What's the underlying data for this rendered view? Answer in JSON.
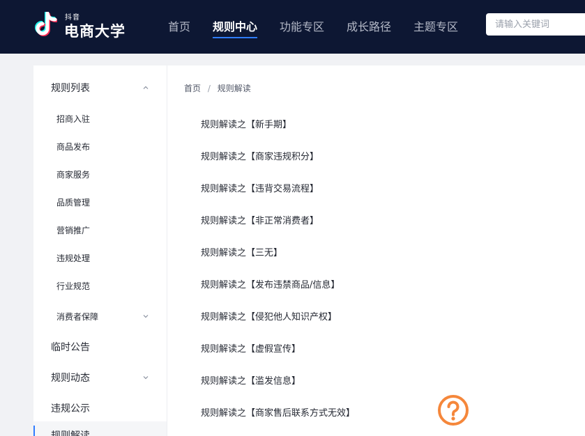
{
  "header": {
    "logo_small": "抖音",
    "logo_big": "电商大学",
    "nav": [
      "首页",
      "规则中心",
      "功能专区",
      "成长路径",
      "主题专区"
    ],
    "active_nav_index": 1,
    "search_placeholder": "请输入关键词"
  },
  "sidebar": {
    "group_rules_list": "规则列表",
    "sub_items": [
      "招商入驻",
      "商品发布",
      "商家服务",
      "品质管理",
      "营销推广",
      "违规处理",
      "行业规范",
      "消费者保障"
    ],
    "temp_notice": "临时公告",
    "rule_updates": "规则动态",
    "violation_notice": "违规公示",
    "rule_interpretation": "规则解读"
  },
  "breadcrumb": {
    "home": "首页",
    "separator": "/",
    "current": "规则解读"
  },
  "articles": [
    "规则解读之【新手期】",
    "规则解读之【商家违规积分】",
    "规则解读之【违背交易流程】",
    "规则解读之【非正常消费者】",
    "规则解读之【三无】",
    "规则解读之【发布违禁商品/信息】",
    "规则解读之【侵犯他人知识产权】",
    "规则解读之【虚假宣传】",
    "规则解读之【滥发信息】",
    "规则解读之【商家售后联系方式无效】"
  ],
  "colors": {
    "header_bg": "#0d1733",
    "accent": "#2f7cff",
    "help_icon": "#f5873b"
  },
  "icons": {
    "logo": "douyin-logo",
    "expand": "chevron-icon",
    "help": "question-help-icon"
  }
}
